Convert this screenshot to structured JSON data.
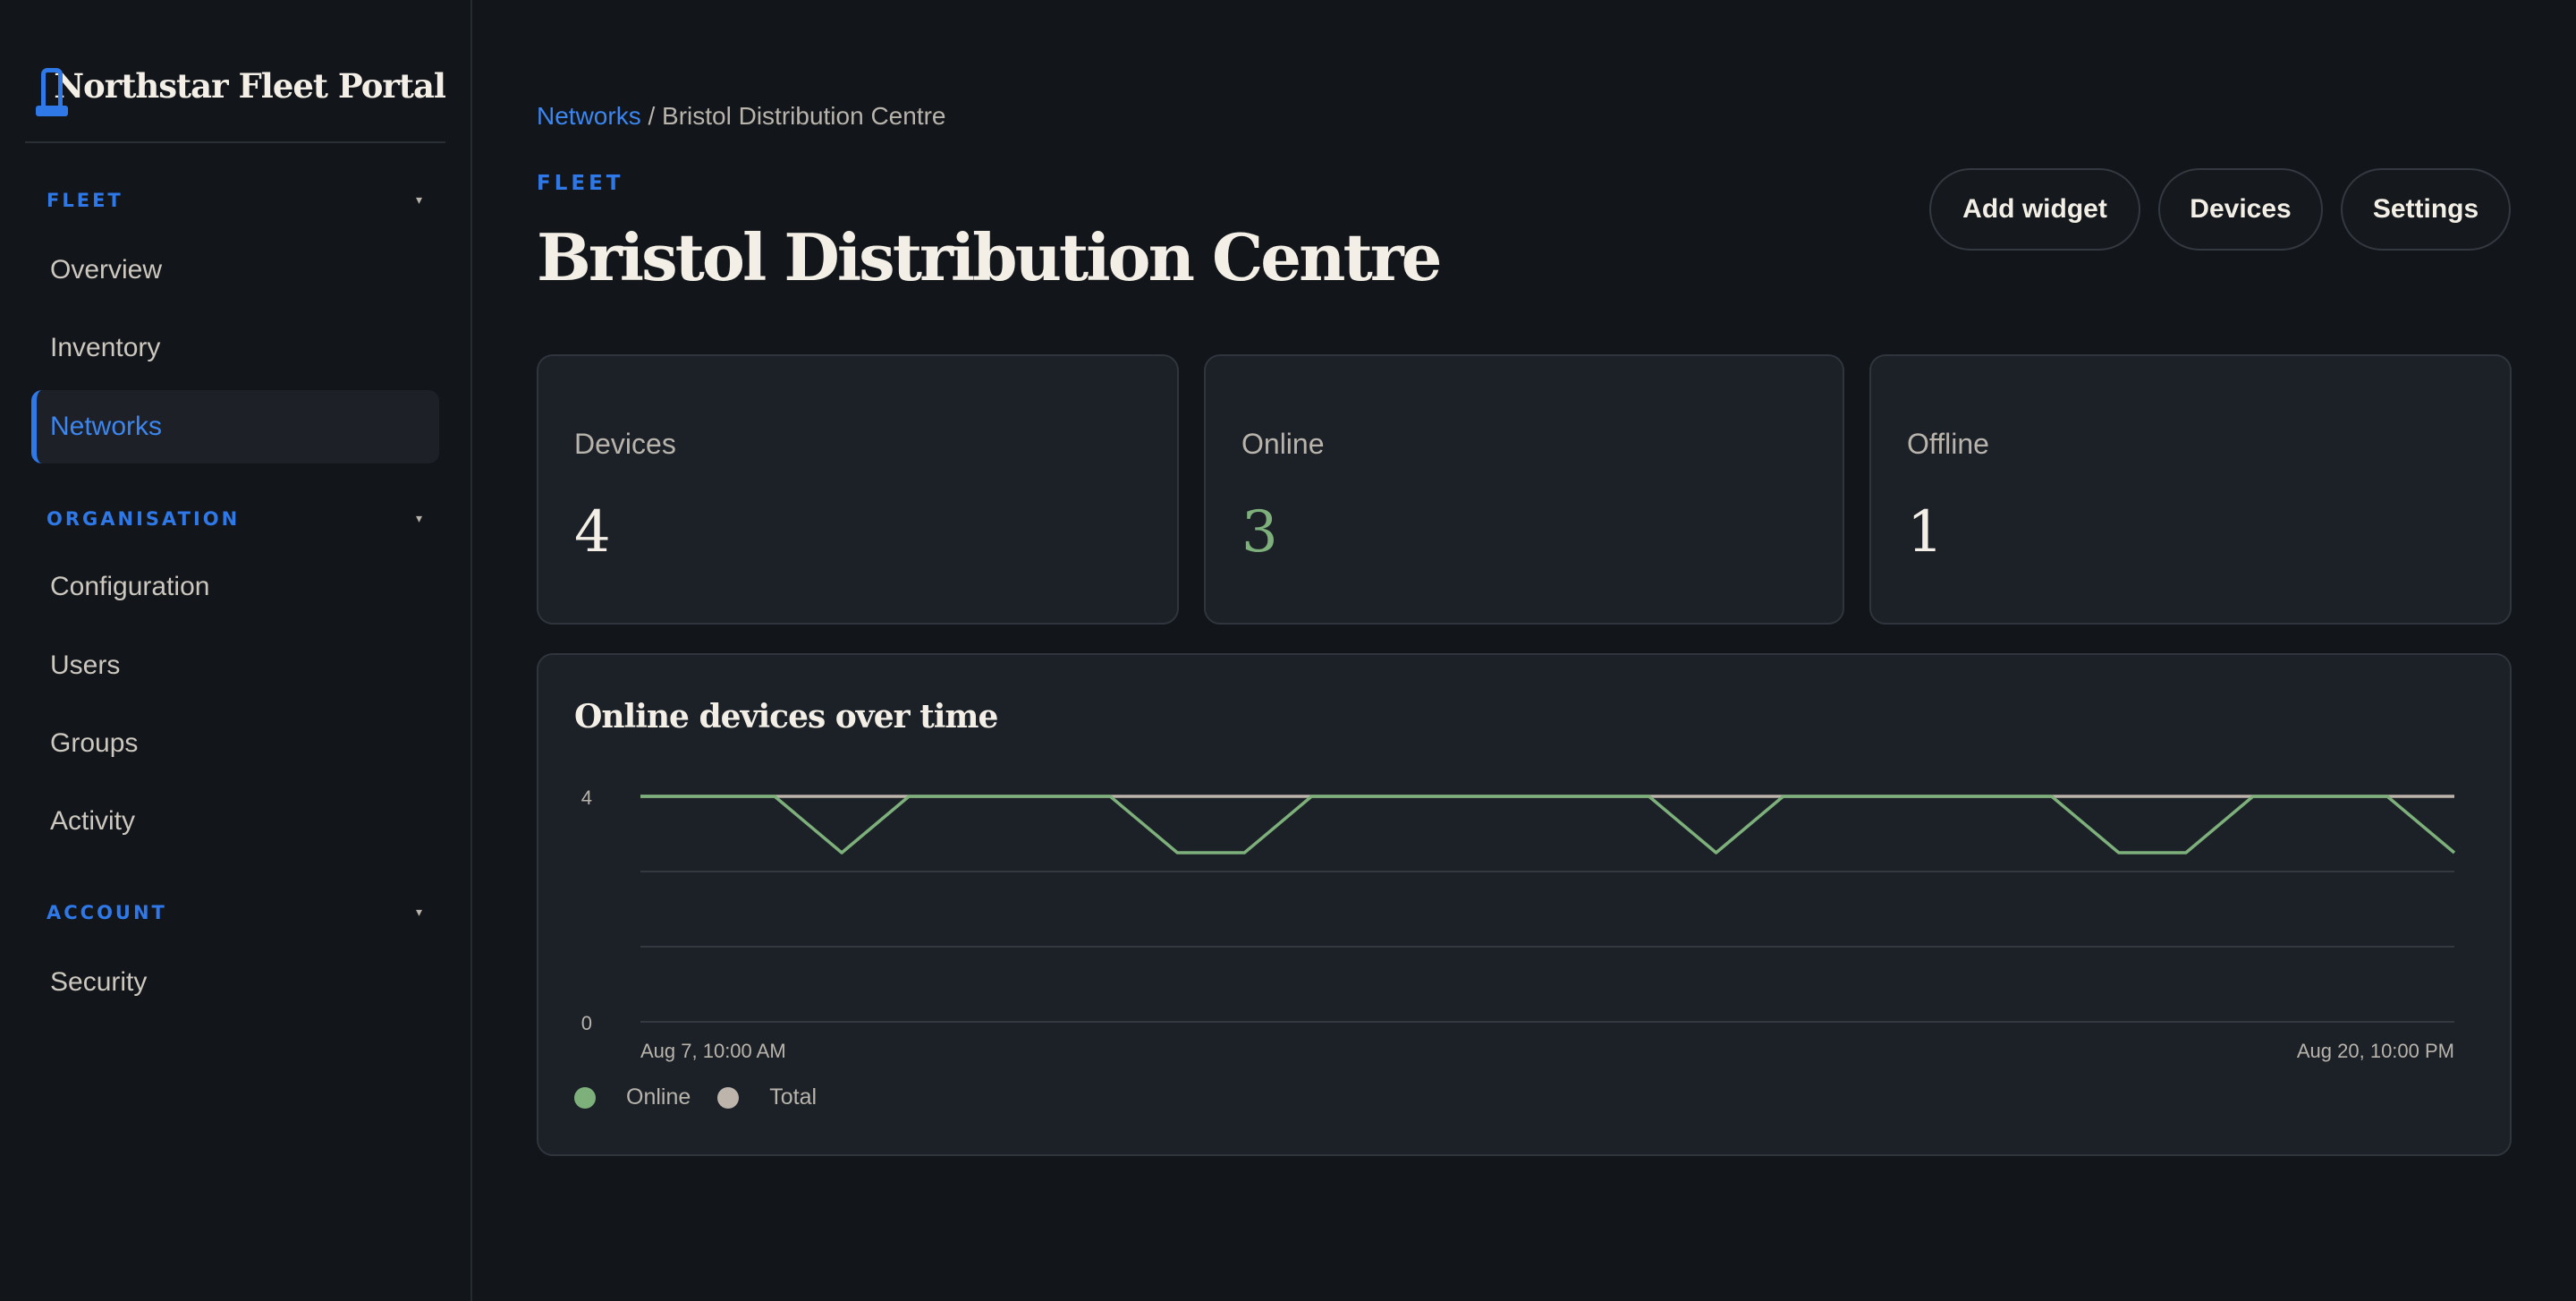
{
  "app": {
    "title": "Northstar Fleet Portal"
  },
  "sidebar": {
    "sections": [
      {
        "label": "FLEET",
        "items": [
          "Overview",
          "Inventory",
          "Networks"
        ]
      },
      {
        "label": "ORGANISATION",
        "items": [
          "Configuration",
          "Users",
          "Groups",
          "Activity"
        ]
      },
      {
        "label": "ACCOUNT",
        "items": [
          "Security"
        ]
      }
    ],
    "active_item": "Networks",
    "caret": "▾"
  },
  "breadcrumb": {
    "parent": "Networks",
    "separator": " / ",
    "current": "Bristol Distribution Centre"
  },
  "header": {
    "eyebrow": "FLEET",
    "title": "Bristol Distribution Centre",
    "buttons": {
      "add_widget": "Add widget",
      "devices": "Devices",
      "settings": "Settings"
    }
  },
  "stats": [
    {
      "label": "Devices",
      "value": "4"
    },
    {
      "label": "Online",
      "value": "3"
    },
    {
      "label": "Offline",
      "value": "1"
    }
  ],
  "colors": {
    "accent": "#2f78e8",
    "online": "#7db07a",
    "total": "#bdb5ac"
  },
  "chart_data": {
    "type": "line",
    "title": "Online devices over time",
    "ylim": [
      0,
      4
    ],
    "y_ticks": [
      0,
      4
    ],
    "x_labels": {
      "start": "Aug 7, 10:00 AM",
      "end": "Aug 20, 10:00 PM"
    },
    "x": [
      0,
      7.4,
      11.1,
      14.8,
      25.9,
      29.6,
      33.3,
      37.0,
      55.6,
      59.3,
      63.0,
      77.8,
      81.5,
      85.2,
      88.9,
      96.3,
      100
    ],
    "series": [
      {
        "name": "Online",
        "color": "#7db07a",
        "values": [
          4,
          4,
          3,
          4,
          4,
          3,
          3,
          4,
          4,
          3,
          4,
          4,
          3,
          3,
          4,
          4,
          3
        ]
      },
      {
        "name": "Total",
        "color": "#bdb5ac",
        "values": [
          4,
          4,
          4,
          4,
          4,
          4,
          4,
          4,
          4,
          4,
          4,
          4,
          4,
          4,
          4,
          4,
          4
        ]
      }
    ],
    "grid": true,
    "legend": "bottom-left"
  }
}
